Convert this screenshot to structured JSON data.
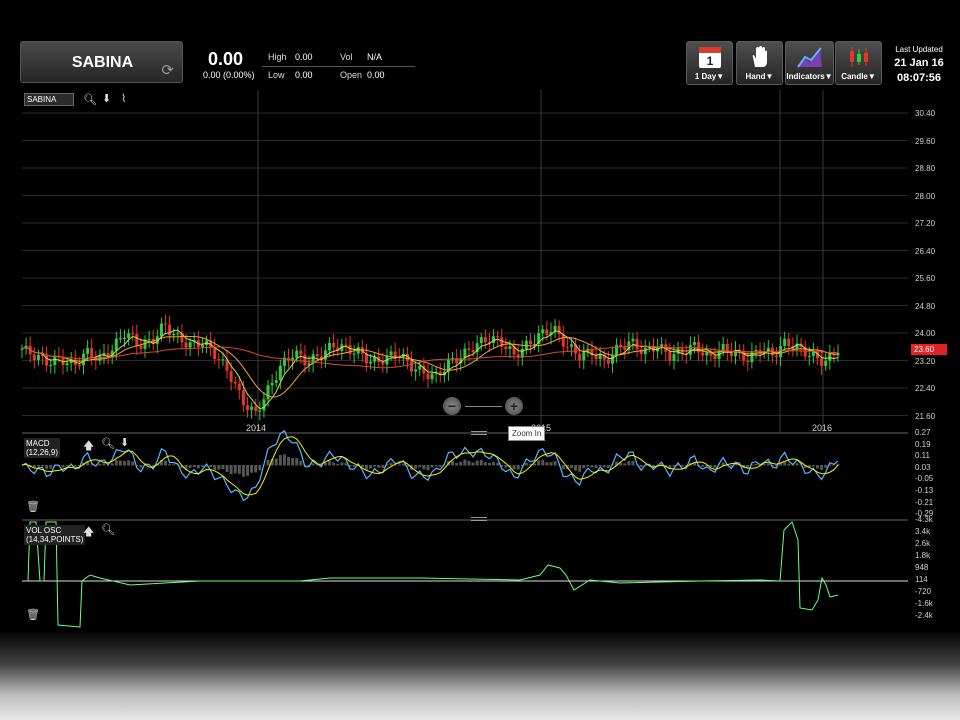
{
  "header": {
    "symbol": "SABINA",
    "price": "0.00",
    "change": "0.00 (0.00%)",
    "high_label": "High",
    "high_value": "0.00",
    "low_label": "Low",
    "low_value": "0.00",
    "vol_label": "Vol",
    "vol_value": "N/A",
    "open_label": "Open",
    "open_value": "0.00"
  },
  "toolbar": {
    "calendar_day": "1",
    "period_label": "1 Day▼",
    "hand_label": "Hand▼",
    "indicators_label": "Indicators▼",
    "candle_label": "Candle▼"
  },
  "last_updated": {
    "label": "Last Updated",
    "date": "21 Jan 16",
    "time": "08:07:56"
  },
  "chart_toolbar": {
    "symbol_input": "SABINA"
  },
  "price_axis": [
    "30.40",
    "29.60",
    "28.80",
    "28.00",
    "27.20",
    "26.40",
    "25.60",
    "24.80",
    "24.00",
    "23.20",
    "22.40",
    "21.60"
  ],
  "last_price_badge": "23.60",
  "x_axis": [
    "2014",
    "2015",
    "2016"
  ],
  "macd": {
    "label": "MACD",
    "params": "(12,26,9)",
    "axis": [
      "0.27",
      "0.19",
      "0.11",
      "0.03",
      "-0.05",
      "-0.13",
      "-0.21",
      "-0.29"
    ]
  },
  "vol_osc": {
    "label": "VOL OSC",
    "params": "(14,34,POINTS)",
    "axis": [
      "-4.3k",
      "3.4k",
      "2.6k",
      "1.8k",
      "948",
      "114",
      "-720",
      "-1.6k",
      "-2.4k"
    ]
  },
  "zoom_tooltip": "Zoom In",
  "colors": {
    "up": "#2ecc40",
    "down": "#e8352c",
    "last_badge": "#e02424",
    "macd": "#5ab4ff",
    "signal": "#f2f200",
    "osc": "#6dff7a"
  },
  "chart_data": {
    "type": "candlestick",
    "title": "SABINA",
    "ylim": [
      21.6,
      30.4
    ],
    "x_tick_labels": [
      "2014",
      "2015",
      "2016"
    ],
    "close_series": [
      23.6,
      23.4,
      23.2,
      23.3,
      23.1,
      23.5,
      23.3,
      23.6,
      24.1,
      23.7,
      23.8,
      24.3,
      23.9,
      23.7,
      23.8,
      23.4,
      22.9,
      22.1,
      21.7,
      22.4,
      23.1,
      23.5,
      23.2,
      23.4,
      23.7,
      23.6,
      23.5,
      23.2,
      23.3,
      23.5,
      23.1,
      22.9,
      22.8,
      23.2,
      23.4,
      23.7,
      23.9,
      23.8,
      23.4,
      23.7,
      24.0,
      24.2,
      23.7,
      23.4,
      23.5,
      23.2,
      23.6,
      23.8,
      23.5,
      23.7,
      23.4,
      23.5,
      23.7,
      23.3,
      23.6,
      23.5,
      23.3,
      23.6,
      23.4,
      23.8,
      23.6,
      23.4,
      23.2,
      23.6
    ],
    "last": 23.6
  }
}
